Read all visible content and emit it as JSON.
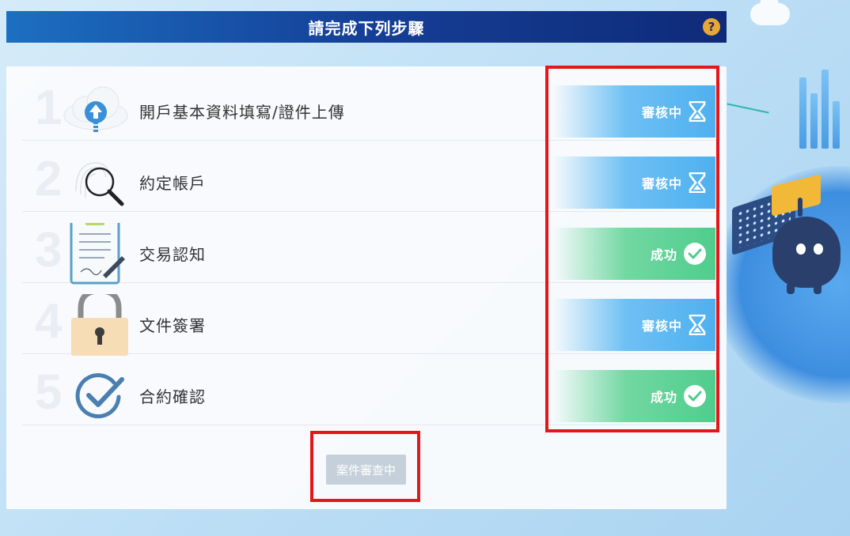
{
  "header": {
    "title": "請完成下列步驟",
    "help_icon": "question-circle-icon"
  },
  "steps": [
    {
      "number": "1",
      "label": "開戶基本資料填寫/證件上傳",
      "icon": "cloud-upload-icon",
      "status": "審核中",
      "status_type": "pending",
      "status_icon": "hourglass-icon"
    },
    {
      "number": "2",
      "label": "約定帳戶",
      "icon": "magnifier-fingerprint-icon",
      "status": "審核中",
      "status_type": "pending",
      "status_icon": "hourglass-icon"
    },
    {
      "number": "3",
      "label": "交易認知",
      "icon": "clipboard-document-icon",
      "status": "成功",
      "status_type": "success",
      "status_icon": "check-circle-icon"
    },
    {
      "number": "4",
      "label": "文件簽署",
      "icon": "padlock-icon",
      "status": "審核中",
      "status_type": "pending",
      "status_icon": "hourglass-icon"
    },
    {
      "number": "5",
      "label": "合約確認",
      "icon": "check-circle-outline-icon",
      "status": "成功",
      "status_type": "success",
      "status_icon": "check-circle-icon"
    }
  ],
  "submit": {
    "label": "案件審查中"
  },
  "colors": {
    "header": "#153f97",
    "pending": "#4fb0ee",
    "success": "#4fcd8c",
    "highlight": "#e4161a"
  }
}
